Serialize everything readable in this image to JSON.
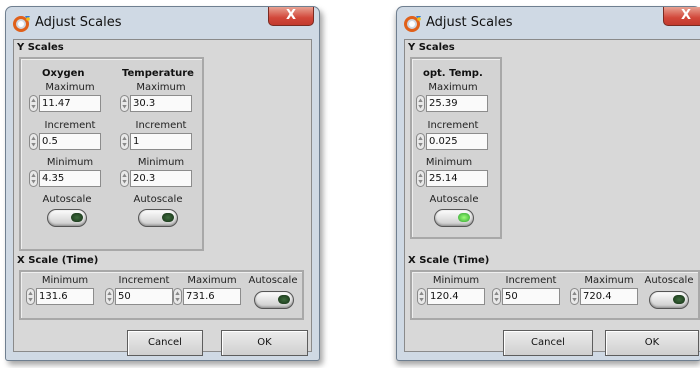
{
  "dialog1": {
    "title": "Adjust Scales",
    "close_glyph": "X",
    "y_section": "Y Scales",
    "y_columns": [
      {
        "name": "Oxygen",
        "max_label": "Maximum",
        "max": "11.47",
        "inc_label": "Increment",
        "inc": "0.5",
        "min_label": "Minimum",
        "min": "4.35",
        "auto_label": "Autoscale",
        "autoscale_on": false
      },
      {
        "name": "Temperature",
        "max_label": "Maximum",
        "max": "30.3",
        "inc_label": "Increment",
        "inc": "1",
        "min_label": "Minimum",
        "min": "20.3",
        "auto_label": "Autoscale",
        "autoscale_on": false
      }
    ],
    "x_section": "X Scale (Time)",
    "x": {
      "min_label": "Minimum",
      "min": "131.6",
      "inc_label": "Increment",
      "inc": "50",
      "max_label": "Maximum",
      "max": "731.6",
      "auto_label": "Autoscale",
      "autoscale_on": false
    },
    "cancel": "Cancel",
    "ok": "OK"
  },
  "dialog2": {
    "title": "Adjust Scales",
    "close_glyph": "X",
    "y_section": "Y Scales",
    "y_columns": [
      {
        "name": "opt. Temp.",
        "max_label": "Maximum",
        "max": "25.39",
        "inc_label": "Increment",
        "inc": "0.025",
        "min_label": "Minimum",
        "min": "25.14",
        "auto_label": "Autoscale",
        "autoscale_on": true
      }
    ],
    "x_section": "X Scale (Time)",
    "x": {
      "min_label": "Minimum",
      "min": "120.4",
      "inc_label": "Increment",
      "inc": "50",
      "max_label": "Maximum",
      "max": "720.4",
      "auto_label": "Autoscale",
      "autoscale_on": false
    },
    "cancel": "Cancel",
    "ok": "OK"
  },
  "colors": {
    "led_off": "#153015",
    "led_on": "#2ea12e",
    "close": "#d2473a"
  },
  "icons": [
    "app-icon",
    "close-icon",
    "spinner-icon"
  ]
}
